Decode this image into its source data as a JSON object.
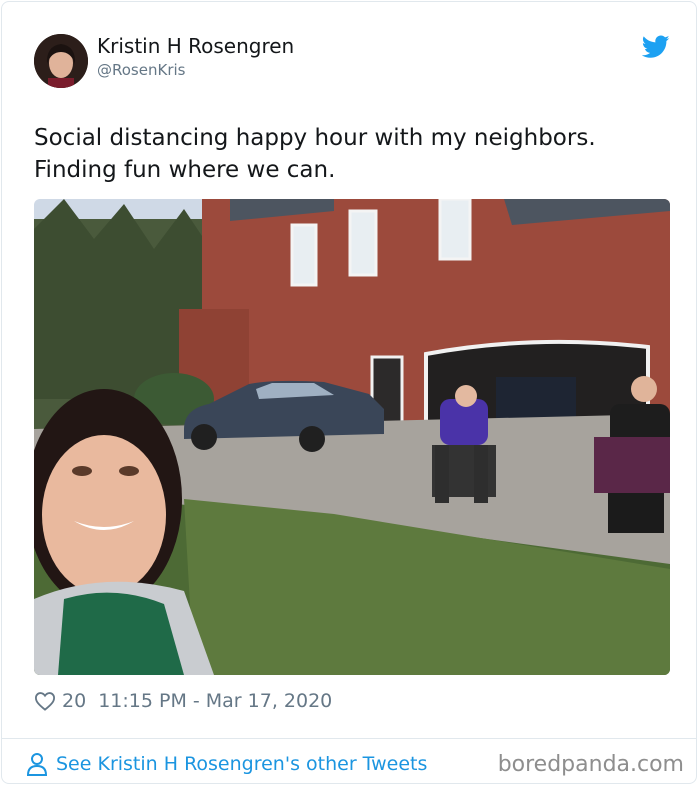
{
  "tweet": {
    "author_name": "Kristin H Rosengren",
    "author_handle": "@RosenKris",
    "text_lines": [
      "Social distancing happy hour with my neighbors.",
      "Finding fun where we can."
    ],
    "likes": "20",
    "timestamp": "11:15 PM - Mar 17, 2020"
  },
  "footer": {
    "other_tweets_link": "See Kristin H Rosengren's other Tweets",
    "watermark": "boredpanda.com"
  },
  "icons": {
    "logo": "twitter-bird-icon",
    "like": "heart-icon",
    "profile": "person-icon"
  },
  "colors": {
    "twitter_blue": "#1da1f2",
    "link_blue": "#1b95e0",
    "text": "#14171a",
    "muted": "#657786"
  }
}
